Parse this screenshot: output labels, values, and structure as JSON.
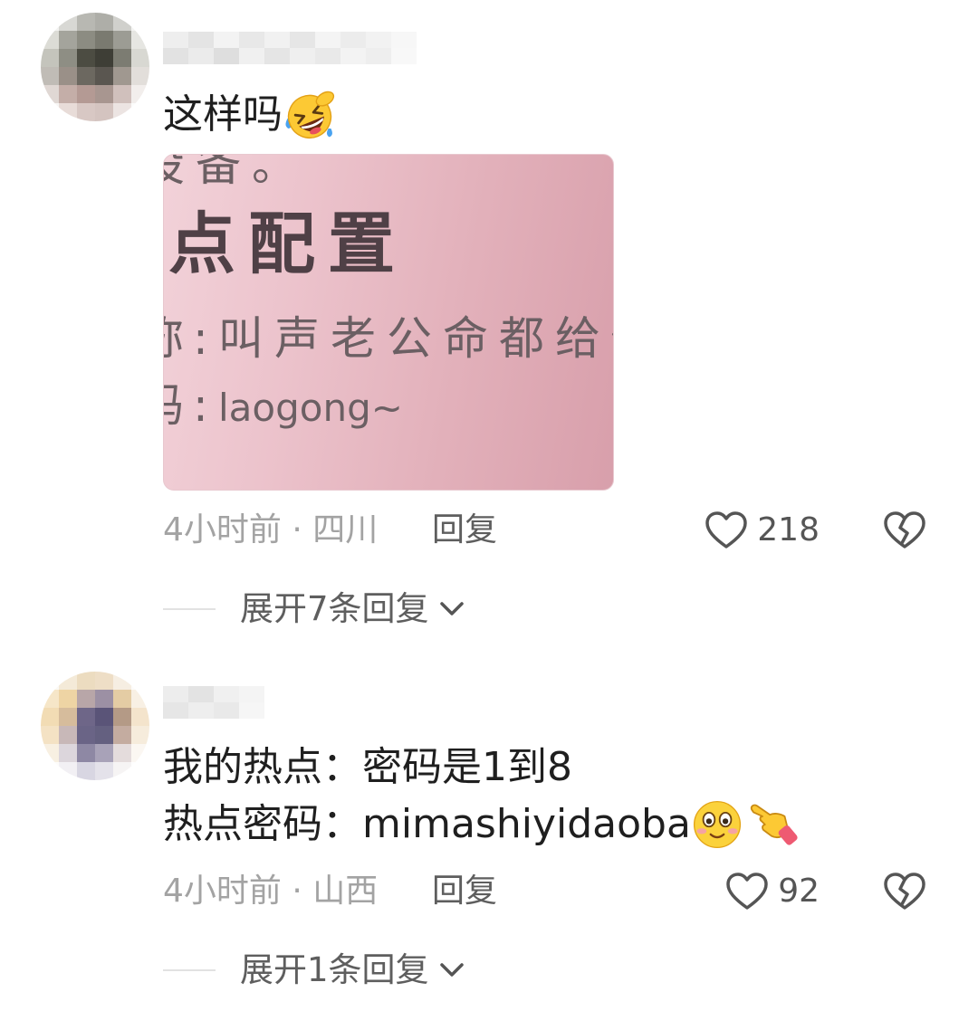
{
  "comments": [
    {
      "text_lines": [
        "这样吗"
      ],
      "emojis": [
        "rofl-emoji-icon"
      ],
      "image_text": {
        "line1": "设备。",
        "line2": "点配置",
        "line3_label": "称:",
        "line3_value": "叫声老公命都给你",
        "line4_label": "码:",
        "line4_value": "laogong~"
      },
      "time_location": "4小时前 · 四川",
      "reply_label": "回复",
      "like_count": "218",
      "expand_label": "展开7条回复"
    },
    {
      "text_lines": [
        "我的热点：密码是1到8",
        "热点密码：mimashiyidaoba"
      ],
      "emojis": [
        "shy-smile-emoji-icon",
        "pointing-hand-emoji-icon"
      ],
      "time_location": "4小时前 · 山西",
      "reply_label": "回复",
      "like_count": "92",
      "expand_label": "展开1条回复"
    }
  ],
  "icons": {
    "like": "heart-outline-icon",
    "dislike": "broken-heart-icon",
    "expand": "chevron-down-icon"
  },
  "colors": {
    "text": "#1f1f1f",
    "meta": "#a3a3a3",
    "action": "#5e5e5e",
    "count": "#555555",
    "divider": "#e2e2e2",
    "image_pink": "#e2b0ba"
  }
}
